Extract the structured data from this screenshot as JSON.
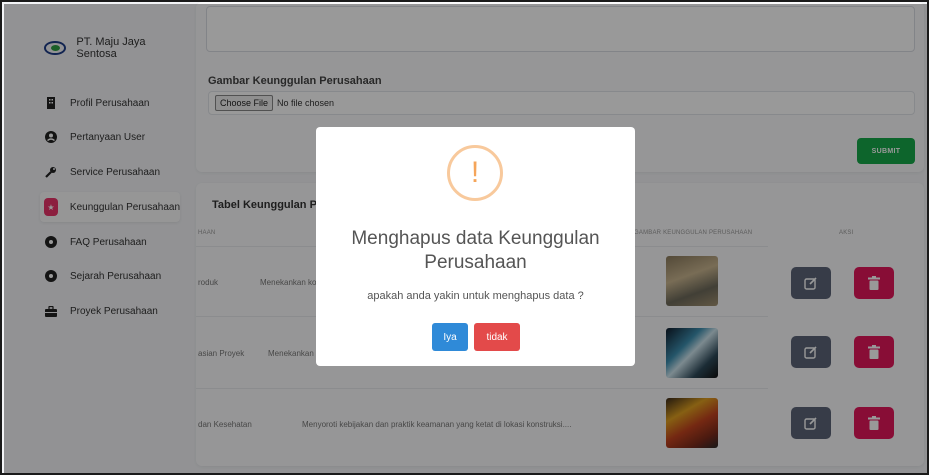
{
  "brand": {
    "name": "PT. Maju Jaya Sentosa",
    "logo_icon": "company-logo"
  },
  "sidebar": {
    "items": [
      {
        "label": "Profil Perusahaan",
        "icon": "building-icon"
      },
      {
        "label": "Pertanyaan User",
        "icon": "user-circle-icon"
      },
      {
        "label": "Service Perusahaan",
        "icon": "wrench-icon"
      },
      {
        "label": "Keunggulan Perusahaan",
        "icon": "star-icon",
        "active": true
      },
      {
        "label": "FAQ Perusahaan",
        "icon": "info-icon"
      },
      {
        "label": "Sejarah Perusahaan",
        "icon": "history-icon"
      },
      {
        "label": "Proyek Perusahaan",
        "icon": "briefcase-icon"
      }
    ]
  },
  "form": {
    "image_label": "Gambar Keunggulan Perusahaan",
    "choose_file": "Choose File",
    "no_file": "No file chosen",
    "submit": "SUBMIT"
  },
  "table": {
    "title": "Tabel Keunggulan Per",
    "headers": {
      "col_name": "HAAN",
      "col_image": "GAMBAR KEUNGGULAN PERUSAHAAN",
      "col_action": "AKSI"
    },
    "rows": [
      {
        "name": "roduk",
        "desc": "Menekankan ko"
      },
      {
        "name": "asian Proyek",
        "desc": "Menekankan"
      },
      {
        "name": "dan Kesehatan",
        "desc": "Menyoroti kebijakan dan praktik keamanan yang ketat di lokasi konstruksi...."
      }
    ]
  },
  "modal": {
    "icon_glyph": "!",
    "title": "Menghapus data Keunggulan Perusahaan",
    "text": "apakah anda yakin untuk menghapus data ?",
    "confirm": "Iya",
    "cancel": "tidak"
  },
  "colors": {
    "active_nav": "#e9356a",
    "submit": "#17a84a",
    "edit_button": "#5c6478",
    "delete_button": "#e3165b",
    "confirm_button": "#2f8ad8",
    "cancel_button": "#e34a4a",
    "warning": "#f5a55a"
  }
}
